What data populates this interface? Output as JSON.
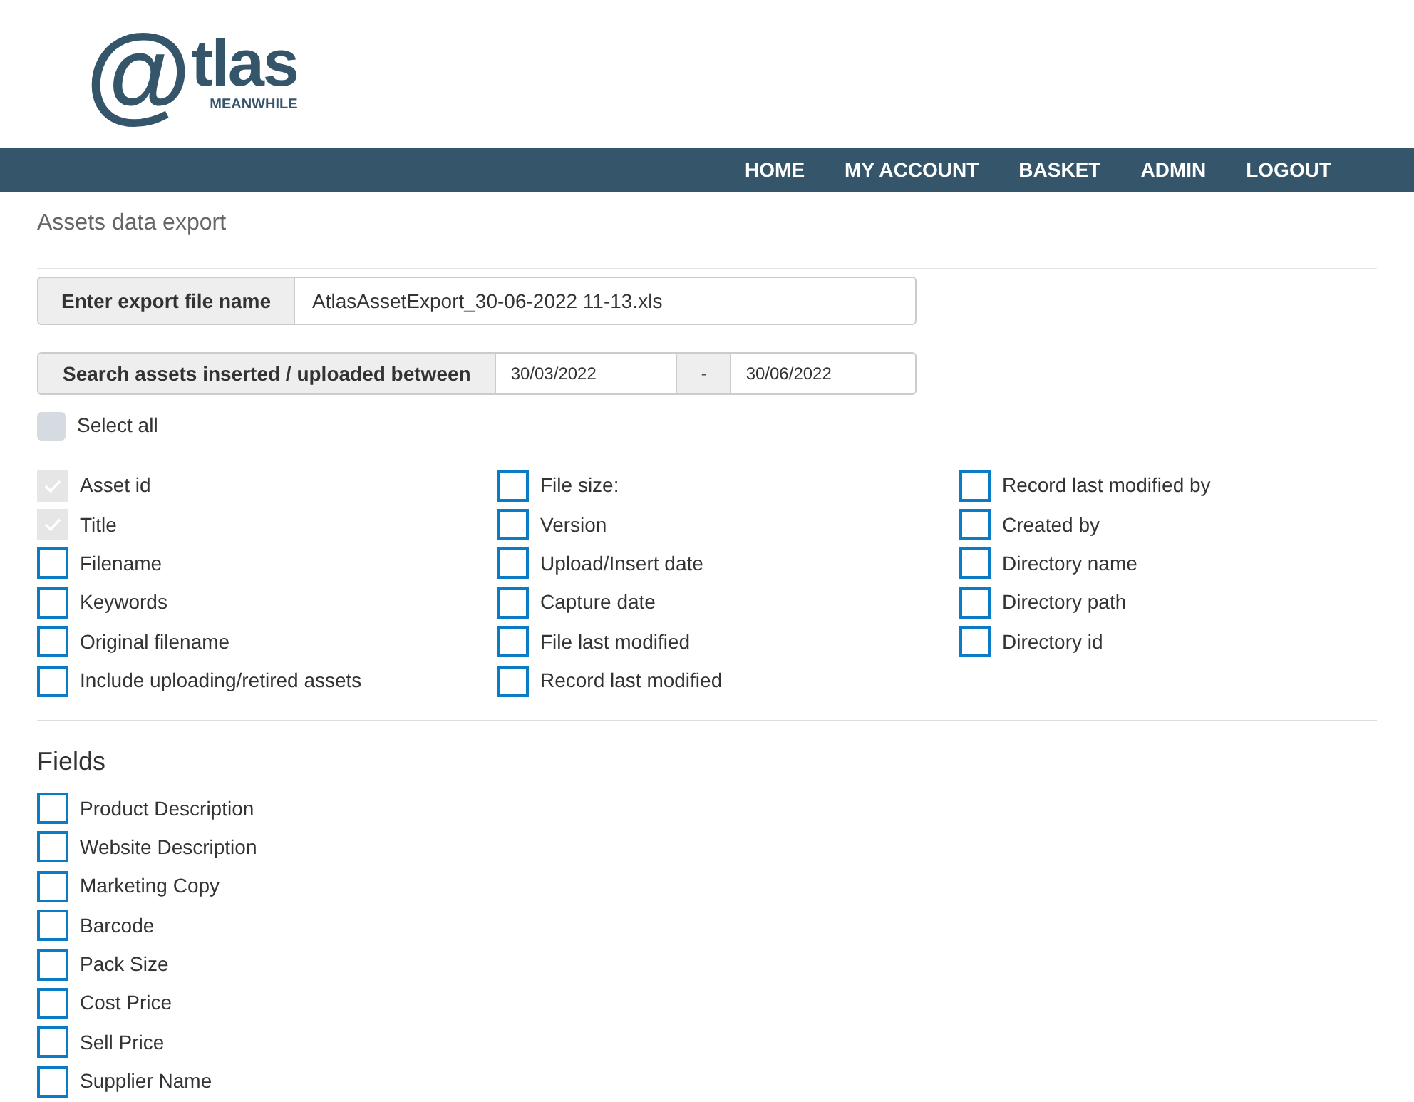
{
  "logo": {
    "mark": "@",
    "word": "tlas",
    "tagline": "MEANWHILE"
  },
  "nav": [
    "HOME",
    "MY ACCOUNT",
    "BASKET",
    "ADMIN",
    "LOGOUT"
  ],
  "page_title": "Assets data export",
  "export_file": {
    "label": "Enter export file name",
    "value": "AtlasAssetExport_30-06-2022 11-13.xls"
  },
  "date_range": {
    "label": "Search assets inserted / uploaded between",
    "from": "30/03/2022",
    "separator": "-",
    "to": "30/06/2022"
  },
  "select_all": {
    "label": "Select all",
    "checked": false
  },
  "columns": [
    [
      {
        "label": "Asset id",
        "checked": true,
        "disabled": true
      },
      {
        "label": "Title",
        "checked": true,
        "disabled": true
      },
      {
        "label": "Filename",
        "checked": false,
        "disabled": false
      },
      {
        "label": "Keywords",
        "checked": false,
        "disabled": false
      },
      {
        "label": "Original filename",
        "checked": false,
        "disabled": false
      },
      {
        "label": "Include uploading/retired assets",
        "checked": false,
        "disabled": false
      }
    ],
    [
      {
        "label": "File size:",
        "checked": false,
        "disabled": false
      },
      {
        "label": "Version",
        "checked": false,
        "disabled": false
      },
      {
        "label": "Upload/Insert date",
        "checked": false,
        "disabled": false
      },
      {
        "label": "Capture date",
        "checked": false,
        "disabled": false
      },
      {
        "label": "File last modified",
        "checked": false,
        "disabled": false
      },
      {
        "label": "Record last modified",
        "checked": false,
        "disabled": false
      }
    ],
    [
      {
        "label": "Record last modified by",
        "checked": false,
        "disabled": false
      },
      {
        "label": "Created by",
        "checked": false,
        "disabled": false
      },
      {
        "label": "Directory name",
        "checked": false,
        "disabled": false
      },
      {
        "label": "Directory path",
        "checked": false,
        "disabled": false
      },
      {
        "label": "Directory id",
        "checked": false,
        "disabled": false
      }
    ]
  ],
  "fields": {
    "heading": "Fields",
    "items": [
      {
        "label": "Product Description",
        "checked": false,
        "disabled": false
      },
      {
        "label": "Website Description",
        "checked": false,
        "disabled": false
      },
      {
        "label": "Marketing Copy",
        "checked": false,
        "disabled": false
      },
      {
        "label": "Barcode",
        "checked": false,
        "disabled": false
      },
      {
        "label": "Pack Size",
        "checked": false,
        "disabled": false
      },
      {
        "label": "Cost Price",
        "checked": false,
        "disabled": false
      },
      {
        "label": "Sell Price",
        "checked": false,
        "disabled": false
      },
      {
        "label": "Supplier Name",
        "checked": false,
        "disabled": false
      }
    ]
  }
}
